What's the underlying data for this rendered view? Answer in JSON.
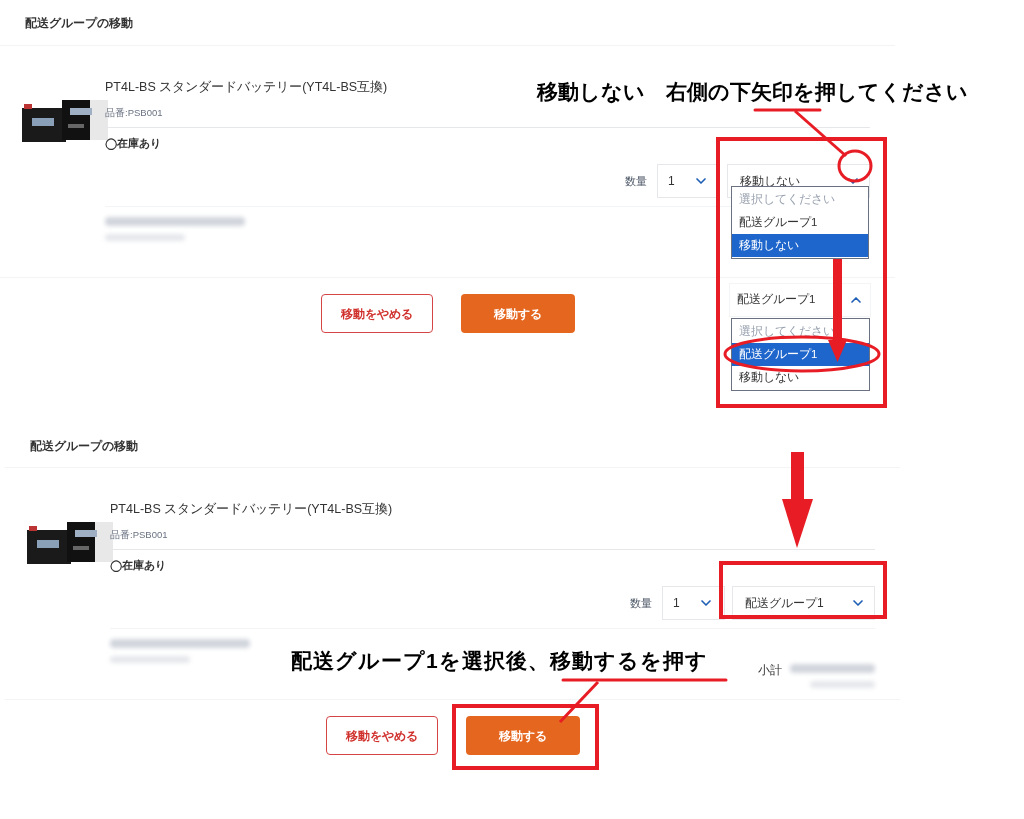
{
  "panels": [
    {
      "title": "配送グループの移動",
      "product": {
        "name": "PT4L-BS スタンダードバッテリー(YT4L-BS互換)",
        "sku": "品番:PSB001",
        "stock": "◯在庫あり",
        "quantity_label": "数量",
        "quantity": "1",
        "group_select": {
          "value": "移動しない",
          "expanded": false
        }
      },
      "buttons": [
        {
          "label": "移動をやめる",
          "kind": "secondary"
        },
        {
          "label": "移動する",
          "kind": "primary"
        }
      ]
    },
    {
      "title": "配送グループの移動",
      "product": {
        "name": "PT4L-BS スタンダードバッテリー(YT4L-BS互換)",
        "sku": "品番:PSB001",
        "stock": "◯在庫あり",
        "quantity_label": "数量",
        "quantity": "1",
        "group_select": {
          "value": "配送グループ1",
          "expanded": false
        },
        "subtotal_label": "小計"
      },
      "buttons": [
        {
          "label": "移動をやめる",
          "kind": "secondary"
        },
        {
          "label": "移動する",
          "kind": "primary"
        }
      ]
    }
  ],
  "dropdown_demo": [
    {
      "kind": "list",
      "options": [
        {
          "label": "選択してください",
          "disabled": true,
          "selected": false
        },
        {
          "label": "配送グループ1",
          "disabled": false,
          "selected": false
        },
        {
          "label": "移動しない",
          "disabled": false,
          "selected": true
        }
      ]
    },
    {
      "kind": "select",
      "value": "配送グループ1",
      "expanded": true,
      "options": [
        {
          "label": "選択してください",
          "disabled": true,
          "selected": false
        },
        {
          "label": "配送グループ1",
          "disabled": false,
          "selected": true
        },
        {
          "label": "移動しない",
          "disabled": false,
          "selected": false
        }
      ]
    }
  ],
  "annotations": {
    "callouts": [
      "移動しない　右側の下矢印を押してください",
      "配送グループ1を選択後、移動するを押す"
    ]
  }
}
